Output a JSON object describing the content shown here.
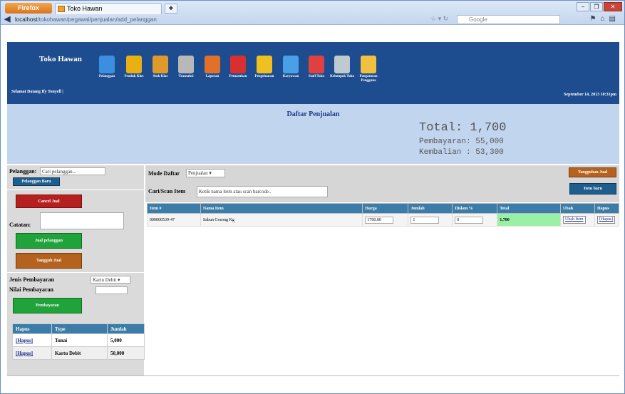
{
  "browser": {
    "app_button": "Firefox",
    "tab_title": "Toko Hawan",
    "new_tab": "+",
    "url_host": "localhost",
    "url_path": "/tokohawan/pegawai/penjualan/add_pelanggan",
    "search_placeholder": "Google",
    "window_controls": [
      "–",
      "❐",
      "✕"
    ]
  },
  "header": {
    "title": "Toko Hawan",
    "user": "Selamat Datang Ify Tonyell |",
    "date": "September 14, 2013 10:31pm",
    "menu": [
      {
        "label": "Pelanggan",
        "icon": "customer-icon",
        "color": "#3a8fe0"
      },
      {
        "label": "Produk Kios",
        "icon": "product-icon",
        "color": "#e8b010"
      },
      {
        "label": "Stok Kios",
        "icon": "stock-box-icon",
        "color": "#e09a2a"
      },
      {
        "label": "Transaksi",
        "icon": "transaction-icon",
        "color": "#b8b8b8"
      },
      {
        "label": "Laporan",
        "icon": "report-icon",
        "color": "#e0702a"
      },
      {
        "label": "Pemasukan",
        "icon": "income-icon",
        "color": "#d83030"
      },
      {
        "label": "Pengeluaran",
        "icon": "expense-icon",
        "color": "#f0c020"
      },
      {
        "label": "Karyawan",
        "icon": "employee-icon",
        "color": "#4aa0e8"
      },
      {
        "label": "Staff Toko",
        "icon": "staff-icon",
        "color": "#e04040"
      },
      {
        "label": "Kelompok Toko",
        "icon": "database-icon",
        "color": "#c0c8d0"
      },
      {
        "label": "Pengaturan Pengguna",
        "icon": "user-settings-icon",
        "color": "#f0c040"
      }
    ]
  },
  "summary": {
    "page_title": "Daftar Penjualan",
    "total": "Total: 1,700",
    "pembayaran": "Pembayaran: 55,000",
    "kembalian": "Kembalian : 53,300"
  },
  "left": {
    "pelanggan_label": "Pelanggan:",
    "pelanggan_placeholder": "Cari pelanggan...",
    "pelanggan_btn": "Pelanggan Baru",
    "cancel_btn": "Cancel Jual",
    "catatan_label": "Catatan:",
    "finish_btn": "Jual pelanggan",
    "suspend_btn": "Tangguh Jual",
    "jenis_label": "Jenis Pembayaran",
    "jenis_value": "Kartu Debit",
    "nilai_label": "Nilai Pembayaran",
    "bayar_btn": "Pembayaran",
    "payments": {
      "headers": [
        "Hapus",
        "Type",
        "Jumlah"
      ],
      "rows": [
        {
          "hapus": "[Hapus]",
          "type": "Tunai",
          "jumlah": "5,000"
        },
        {
          "hapus": "[Hapus]",
          "type": "Kartu Debit",
          "jumlah": "50,000"
        }
      ]
    }
  },
  "main": {
    "mode_label": "Mode Daftar",
    "mode_value": "Penjualan",
    "cari_label": "Cari/Scan Item",
    "cari_value": "Ketik nama item atau scan barcode..",
    "suspended_btn": "Tangguhan Jual",
    "new_item_btn": "Item baru",
    "columns": [
      "Item #",
      "Nama Item",
      "Harga",
      "Jumlah",
      "Diskon %",
      "Total",
      "Ubah",
      "Hapus"
    ],
    "rows": [
      {
        "item": "000000539-47",
        "nama": "Sabun Gosong Kg",
        "harga": "1700.00",
        "jumlah": "1",
        "diskon": "0",
        "total": "1,700",
        "ubah": "Ubah Item",
        "hapus": "[Hapus]"
      }
    ]
  }
}
